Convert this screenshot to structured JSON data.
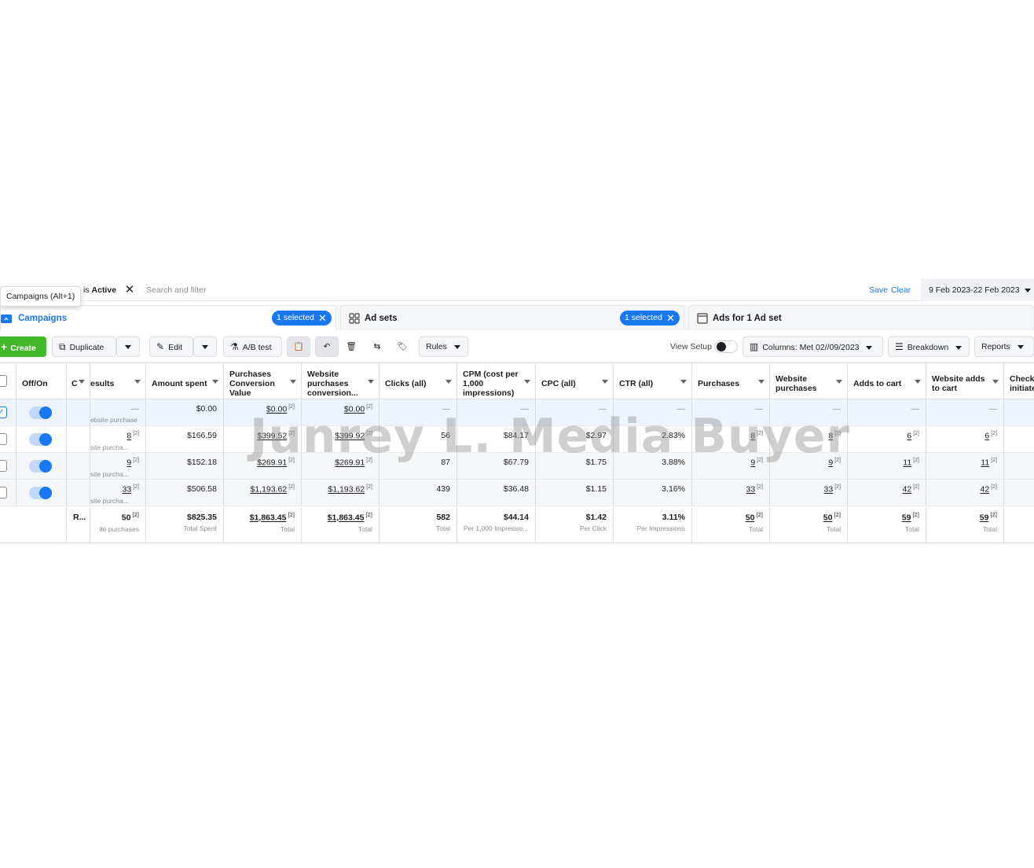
{
  "filter": {
    "chip_prefix": "is",
    "chip_value": "Active",
    "search_placeholder": "Search and filter",
    "save": "Save",
    "clear": "Clear",
    "date_range": "9 Feb 2023-22 Feb 2023"
  },
  "tooltip": "Campaigns (Alt+1)",
  "tabs": {
    "campaigns": {
      "label": "Campaigns",
      "selected": "1 selected"
    },
    "adsets": {
      "label": "Ad sets",
      "selected": "1 selected"
    },
    "ads": {
      "label": "Ads for 1 Ad set"
    }
  },
  "toolbar": {
    "create": "Create",
    "duplicate": "Duplicate",
    "edit": "Edit",
    "ab_test": "A/B test",
    "rules": "Rules",
    "view_setup": "View Setup",
    "columns": "Columns: Met 02//09/2023",
    "breakdown": "Breakdown",
    "reports": "Reports"
  },
  "columns": {
    "off_on": "Off/On",
    "c": "C",
    "results": "esults",
    "amount_spent": "Amount spent",
    "purchases_conv_value": "Purchases Conversion Value",
    "website_purchases_conv": "Website purchases conversion...",
    "clicks": "Clicks (all)",
    "cpm": "CPM (cost per 1,000 impressions)",
    "cpc": "CPC (all)",
    "ctr": "CTR (all)",
    "purchases": "Purchases",
    "website_purchases": "Website purchases",
    "adds_to_cart": "Adds to cart",
    "website_adds_to_cart": "Website adds to cart",
    "checkouts": "Checkc initiate"
  },
  "rows": [
    {
      "results": "—",
      "results_sub": "ebsite purchase",
      "amount": "$0.00",
      "pcv": "$0.00",
      "wpcv": "$0.00",
      "clicks": "—",
      "cpm": "—",
      "cpc": "—",
      "ctr": "—",
      "purchases": "—",
      "wp": "—",
      "atc": "—",
      "watc": "—"
    },
    {
      "results": "8",
      "results_sub": "site purcha...",
      "amount": "$166.59",
      "pcv": "$399.52",
      "wpcv": "$399.92",
      "clicks": "56",
      "cpm": "$84.17",
      "cpc": "$2.97",
      "ctr": "2.83%",
      "purchases": "8",
      "wp": "8",
      "atc": "6",
      "watc": "6"
    },
    {
      "results": "9",
      "results_sub": "site purcha...",
      "amount": "$152.18",
      "pcv": "$269.91",
      "wpcv": "$269.91",
      "clicks": "87",
      "cpm": "$67.79",
      "cpc": "$1.75",
      "ctr": "3.88%",
      "purchases": "9",
      "wp": "9",
      "atc": "11",
      "watc": "11"
    },
    {
      "results": "33",
      "results_sub": "site purcha...",
      "amount": "$506.58",
      "pcv": "$1,193.62",
      "wpcv": "$1,193.62",
      "clicks": "439",
      "cpm": "$36.48",
      "cpc": "$1.15",
      "ctr": "3.16%",
      "purchases": "33",
      "wp": "33",
      "atc": "42",
      "watc": "42"
    }
  ],
  "totals": {
    "label": "R...",
    "results": "50",
    "results_sub": "ite purchases",
    "amount": "$825.35",
    "amount_sub": "Total Spent",
    "pcv": "$1,863.45",
    "pcv_sub": "Total",
    "wpcv": "$1,863.45",
    "wpcv_sub": "Total",
    "clicks": "582",
    "clicks_sub": "Total",
    "cpm": "$44.14",
    "cpm_sub": "Per 1,000 Impressio...",
    "cpc": "$1.42",
    "cpc_sub": "Per Click",
    "ctr": "3.11%",
    "ctr_sub": "Per Impressions",
    "purchases": "50",
    "purchases_sub": "Total",
    "wp": "50",
    "wp_sub": "Total",
    "atc": "59",
    "atc_sub": "Total",
    "watc": "59",
    "watc_sub": "Total"
  },
  "note_sup": "[2]",
  "watermark": "Junrey L. Media Buyer",
  "colors": {
    "accent": "#1877f2",
    "create": "#42b72a"
  }
}
